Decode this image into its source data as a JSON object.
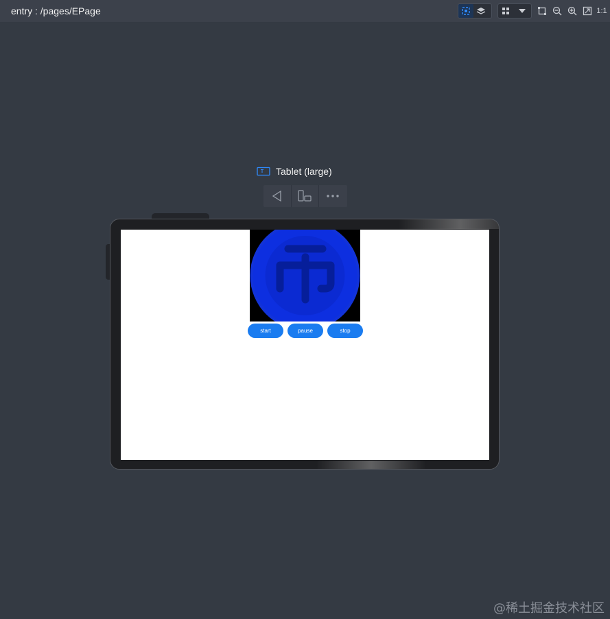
{
  "topbar": {
    "route": "entry : /pages/EPage",
    "icons": [
      "inspector-icon",
      "layers-icon",
      "grid-icon",
      "chevron-down-icon",
      "fit-icon",
      "zoom-out-icon",
      "zoom-in-icon",
      "fullscreen-icon"
    ],
    "ratio_label": "1:1"
  },
  "device": {
    "name": "Tablet (large)",
    "controls": [
      "back-icon",
      "rotate-icon",
      "more-icon"
    ]
  },
  "app": {
    "image": "coin-icon",
    "buttons": {
      "start": "start",
      "pause": "pause",
      "stop": "stop"
    },
    "colors": {
      "button": "#1a7cf0",
      "coin_outer": "#0b3ad6",
      "coin_inner": "#0a2fc8",
      "coin_glyph": "#0620a0"
    }
  },
  "watermark": "@稀土掘金技术社区"
}
